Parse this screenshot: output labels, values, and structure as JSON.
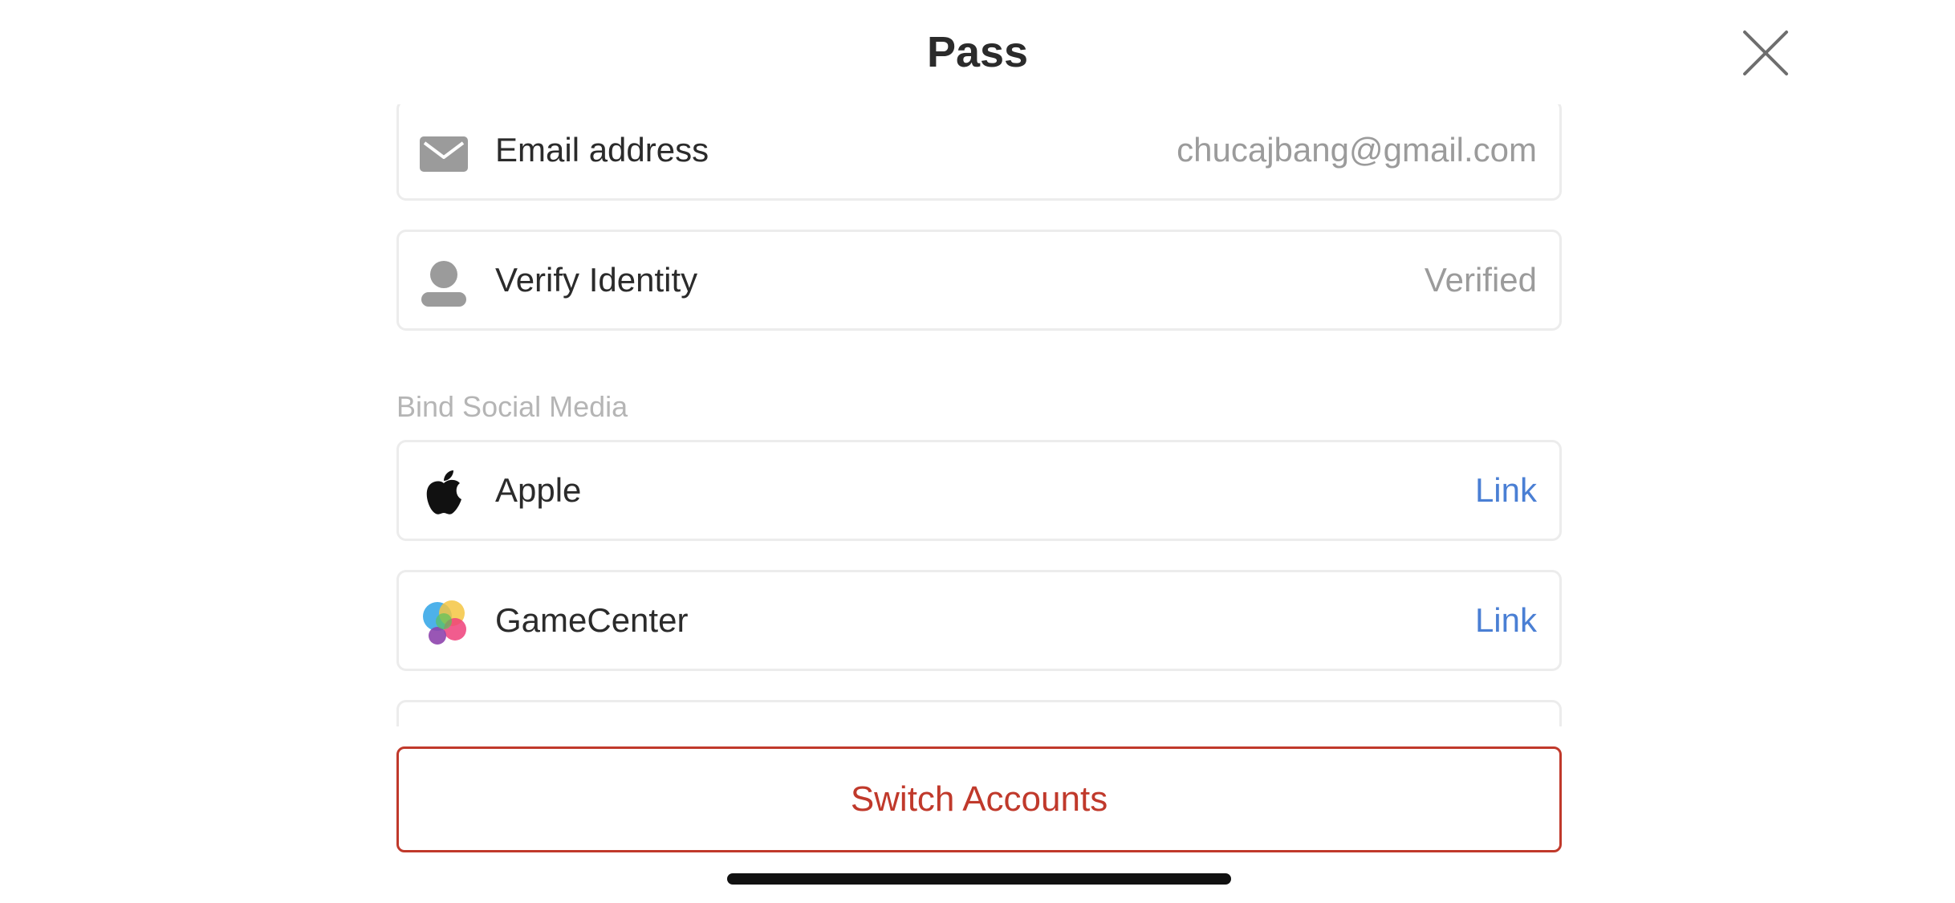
{
  "header": {
    "title": "Pass"
  },
  "account": {
    "email_label": "Email address",
    "email_value": "chucajbang@gmail.com",
    "identity_label": "Verify Identity",
    "identity_value": "Verified"
  },
  "social": {
    "section_label": "Bind Social Media",
    "items": [
      {
        "label": "Apple",
        "action": "Link",
        "icon": "apple-icon"
      },
      {
        "label": "GameCenter",
        "action": "Link",
        "icon": "gamecenter-icon"
      }
    ]
  },
  "footer": {
    "switch_label": "Switch Accounts"
  },
  "colors": {
    "accent_link": "#4a7fd4",
    "danger": "#c0392b",
    "muted_text": "#9b9b9b",
    "section_text": "#b5b5b5"
  }
}
